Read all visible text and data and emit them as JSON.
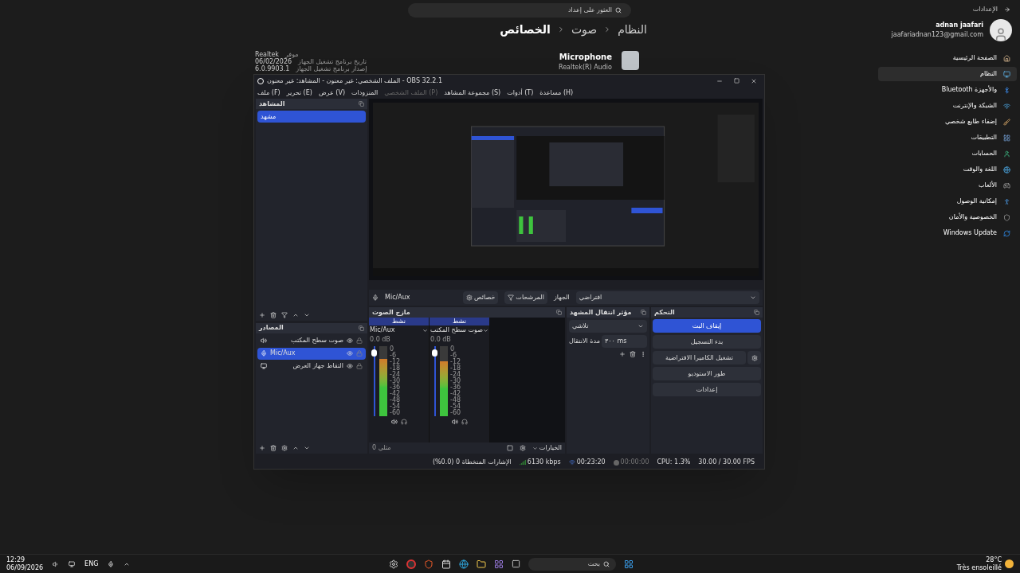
{
  "settings": {
    "title": "الإعدادات",
    "search": {
      "placeholder": "العثور على إعداد"
    },
    "breadcrumb": [
      "النظام",
      "صوت",
      "الخصائص"
    ],
    "user": {
      "name": "adnan jaafari",
      "email": "jaafariadnan123@gmail.com"
    },
    "nav": [
      {
        "kind": "home",
        "label": "الصفحة الرئيسية",
        "selected": false
      },
      {
        "kind": "system",
        "label": "النظام",
        "selected": true
      },
      {
        "kind": "bluetooth",
        "label": "Bluetooth والأجهزة",
        "selected": false
      },
      {
        "kind": "network",
        "label": "الشبكة والإنترنت",
        "selected": false
      },
      {
        "kind": "personalize",
        "label": "إضفاء طابع شخصي",
        "selected": false
      },
      {
        "kind": "apps",
        "label": "التطبيقات",
        "selected": false
      },
      {
        "kind": "accounts",
        "label": "الحسابات",
        "selected": false
      },
      {
        "kind": "time",
        "label": "اللغة والوقت",
        "selected": false
      },
      {
        "kind": "gaming",
        "label": "الألعاب",
        "selected": false
      },
      {
        "kind": "access",
        "label": "إمكانية الوصول",
        "selected": false
      },
      {
        "kind": "privacy",
        "label": "الخصوصية والأمان",
        "selected": false
      },
      {
        "kind": "update",
        "label": "Windows Update",
        "selected": false
      }
    ],
    "device": {
      "name": "Microphone",
      "driver": "Realtek(R) Audio",
      "details": [
        {
          "label": "موفر",
          "value": "Realtek"
        },
        {
          "label": "تاريخ برنامج تشغيل الجهاز",
          "value": "06/02/2026"
        },
        {
          "label": "إصدار برنامج تشغيل الجهاز",
          "value": "6.0.9903.1"
        }
      ]
    }
  },
  "obs": {
    "title": "الملف الشخصي: غير معنون - المشاهد: غير معنون - OBS 32.2.1",
    "menu": [
      {
        "label": "مساعدة (H)",
        "disabled": false
      },
      {
        "label": "أدوات (T)",
        "disabled": false
      },
      {
        "label": "مجموعة المشاهد (S)",
        "disabled": false
      },
      {
        "label": "الملف الشخصي (P)",
        "disabled": true
      },
      {
        "label": "المنزودات",
        "disabled": false
      },
      {
        "label": "عرض (V)",
        "disabled": false
      },
      {
        "label": "تحرير (E)",
        "disabled": false
      },
      {
        "label": "ملف (F)",
        "disabled": false
      }
    ],
    "scenes": {
      "title": "المشاهد",
      "items": [
        {
          "label": "مشهد",
          "selected": true
        }
      ]
    },
    "sources": {
      "title": "المصادر",
      "items": [
        {
          "kind": "audio",
          "label": "صوت سطح المكتب",
          "selected": false
        },
        {
          "kind": "mic",
          "label": "Mic/Aux",
          "selected": true
        },
        {
          "kind": "display",
          "label": "التقاط جهاز العرض",
          "selected": false
        }
      ]
    },
    "context": {
      "source": "Mic/Aux",
      "properties": "خصائص",
      "filters": "المرشحات",
      "device_label": "الجهاز",
      "device_value": "افتراضي"
    },
    "mixer": {
      "title": "مازج الصوت",
      "channels": [
        {
          "header": "نشط",
          "name": "صوت سطح المكتب",
          "db": "0.0 dB",
          "fader": {
            "level": 0.95
          },
          "meter": {
            "level": 0.78
          },
          "scale": [
            "0",
            "-6",
            "-12",
            "-18",
            "-24",
            "-30",
            "-36",
            "-42",
            "-48",
            "-54",
            "-60"
          ]
        },
        {
          "header": "نشط",
          "name": "Mic/Aux",
          "db": "0.0 dB",
          "fader": {
            "level": 0.95
          },
          "meter": {
            "level": 0.82
          },
          "scale": [
            "0",
            "-6",
            "-12",
            "-18",
            "-24",
            "-30",
            "-36",
            "-42",
            "-48",
            "-54",
            "-60"
          ]
        }
      ],
      "footer": "مثلي 0",
      "options": "الخيارات"
    },
    "transitions": {
      "title": "مؤثر انتقال المشهد",
      "value": "تلاشي",
      "duration_label": "مدة الانتقال",
      "duration": "٣٠٠ ms"
    },
    "controls": {
      "title": "التحكم",
      "buttons": [
        {
          "kind": "plain",
          "label": "إيقاف البث",
          "selected": true
        },
        {
          "kind": "plain",
          "label": "بدء التسجيل",
          "selected": false
        },
        {
          "kind": "gear",
          "label": "تشغيل الكاميرا الافتراضية",
          "selected": false
        },
        {
          "kind": "plain",
          "label": "طور الاستوديو",
          "selected": false
        },
        {
          "kind": "plain",
          "label": "إعدادات",
          "selected": false
        }
      ]
    },
    "status": [
      {
        "kind": "fps",
        "text": "30.00 / 30.00 FPS"
      },
      {
        "kind": "cpu",
        "text": "CPU: 1.3%"
      },
      {
        "kind": "record",
        "text": "00:00:00"
      },
      {
        "kind": "stream",
        "text": "00:23:20"
      },
      {
        "kind": "bitrate",
        "text": "6130 kbps"
      },
      {
        "kind": "dropped",
        "text": "الإشارات المتخطاة 0 (0.0%)"
      }
    ]
  },
  "taskbar": {
    "time": "12:29",
    "date": "06/09/2026",
    "lang": "ENG",
    "search": {
      "placeholder": "بحث"
    },
    "weather": {
      "temp": "28°C",
      "desc": "Très ensoleillé"
    }
  }
}
